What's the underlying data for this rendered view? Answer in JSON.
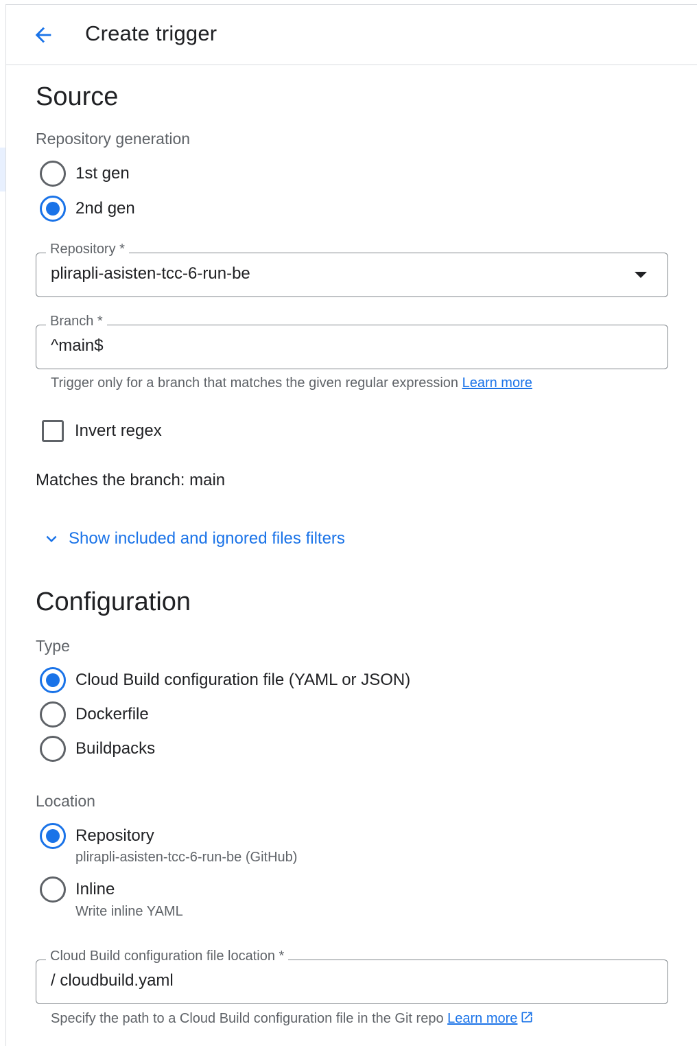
{
  "header": {
    "title": "Create trigger"
  },
  "source": {
    "heading": "Source",
    "repo_generation": {
      "label": "Repository generation",
      "options": [
        {
          "label": "1st gen",
          "selected": false
        },
        {
          "label": "2nd gen",
          "selected": true
        }
      ]
    },
    "repository": {
      "label": "Repository *",
      "value": "plirapli-asisten-tcc-6-run-be"
    },
    "branch": {
      "label": "Branch *",
      "value": "^main$",
      "hint": "Trigger only for a branch that matches the given regular expression",
      "learn_more": "Learn more"
    },
    "invert_regex": {
      "label": "Invert regex",
      "checked": false
    },
    "matches_text": "Matches the branch: main",
    "filters_toggle": "Show included and ignored files filters"
  },
  "configuration": {
    "heading": "Configuration",
    "type": {
      "label": "Type",
      "options": [
        {
          "label": "Cloud Build configuration file (YAML or JSON)",
          "selected": true
        },
        {
          "label": "Dockerfile",
          "selected": false
        },
        {
          "label": "Buildpacks",
          "selected": false
        }
      ]
    },
    "location": {
      "label": "Location",
      "options": [
        {
          "label": "Repository",
          "sublabel": "plirapli-asisten-tcc-6-run-be (GitHub)",
          "selected": true
        },
        {
          "label": "Inline",
          "sublabel": "Write inline YAML",
          "selected": false
        }
      ]
    },
    "file_location": {
      "label": "Cloud Build configuration file location *",
      "value": "/ cloudbuild.yaml",
      "hint": "Specify the path to a Cloud Build configuration file in the Git repo",
      "learn_more": "Learn more"
    }
  },
  "colors": {
    "accent": "#1a73e8",
    "text": "#202124",
    "secondary_text": "#5f6368",
    "border": "#80868b"
  }
}
